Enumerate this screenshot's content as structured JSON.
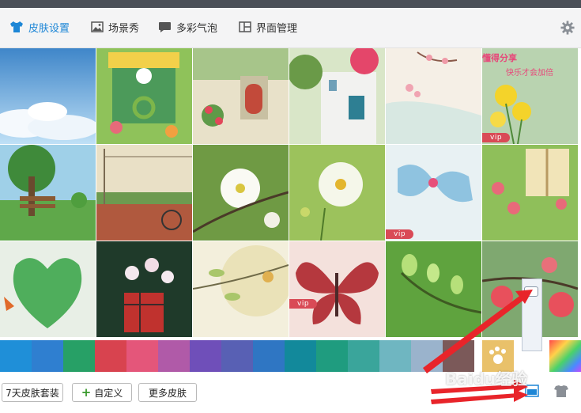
{
  "tabs": [
    {
      "label": "皮肤设置",
      "icon": "shirt-icon",
      "active": true
    },
    {
      "label": "场景秀",
      "icon": "picture-icon",
      "active": false
    },
    {
      "label": "多彩气泡",
      "icon": "chat-bubble-icon",
      "active": false
    },
    {
      "label": "界面管理",
      "icon": "layout-icon",
      "active": false
    }
  ],
  "thumbnails": {
    "vip_label": "vip",
    "tile_1_6_text_line1": "懂得分享",
    "tile_1_6_text_line2": "快乐才会加倍"
  },
  "colors": {
    "accent": "#1d86d6",
    "swatches": [
      "#1f8fd8",
      "#2f7fd0",
      "#27a066",
      "#d8434f",
      "#e4567a",
      "#b05aa8",
      "#6f4fb9",
      "#5860b4",
      "#2f76c3",
      "#12899b",
      "#1f9c7f",
      "#3aa59b",
      "#6fb6c1",
      "#9ab3cc",
      "#7b5959"
    ]
  },
  "buttons": {
    "skin_pack": "7天皮肤套装",
    "custom": "自定义",
    "more_skins": "更多皮肤"
  },
  "watermark": "Baidu经验"
}
